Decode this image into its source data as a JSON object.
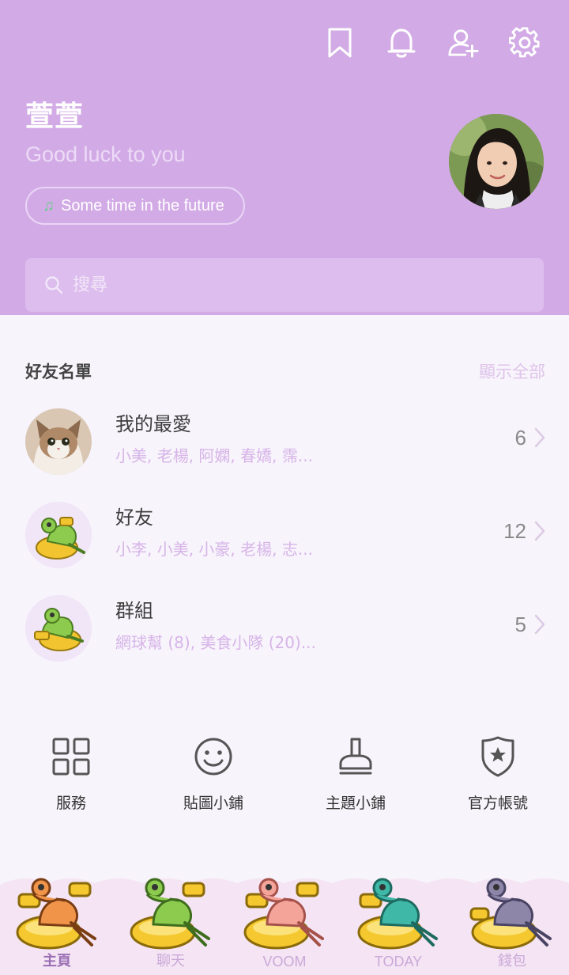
{
  "profile": {
    "name": "萱萱",
    "status": "Good luck to you",
    "music": "Some time in the future"
  },
  "search": {
    "placeholder": "搜尋"
  },
  "friends_section": {
    "title": "好友名單",
    "show_all": "顯示全部",
    "items": [
      {
        "name": "我的最愛",
        "members": "小美, 老楊, 阿嫻, 春嬌, 霈...",
        "count": "6"
      },
      {
        "name": "好友",
        "members": "小李, 小美, 小豪, 老楊, 志...",
        "count": "12"
      },
      {
        "name": "群組",
        "members": "網球幫 (8), 美食小隊 (20)...",
        "count": "5"
      }
    ]
  },
  "shortcuts": [
    {
      "label": "服務",
      "icon": "grid-icon"
    },
    {
      "label": "貼圖小鋪",
      "icon": "smiley-icon"
    },
    {
      "label": "主題小鋪",
      "icon": "brush-icon"
    },
    {
      "label": "官方帳號",
      "icon": "shield-star-icon"
    }
  ],
  "bottom_nav": [
    {
      "label": "主頁",
      "color": "#f0944a"
    },
    {
      "label": "聊天",
      "color": "#8ccb4e"
    },
    {
      "label": "VOOM",
      "color": "#f5a49a"
    },
    {
      "label": "TODAY",
      "color": "#3fb8a8"
    },
    {
      "label": "錢包",
      "color": "#8e86a8"
    }
  ],
  "colors": {
    "header_bg": "#d2abe6",
    "accent_light": "#d7b4e8",
    "page_bg": "#f7f4fb"
  }
}
